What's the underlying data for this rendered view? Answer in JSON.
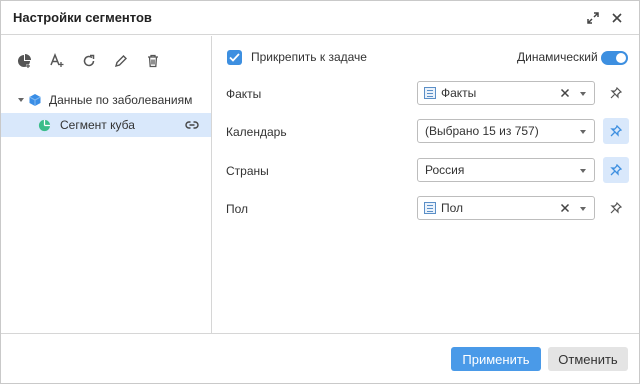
{
  "dialog": {
    "title": "Настройки сегментов"
  },
  "tree": {
    "root_label": "Данные по заболеваниям",
    "child_label": "Сегмент куба"
  },
  "options": {
    "pin_to_task_label": "Прикрепить к задаче",
    "pin_to_task_checked": true,
    "dynamic_label": "Динамический",
    "dynamic_on": true
  },
  "fields": [
    {
      "label": "Факты",
      "value": "Факты"
    },
    {
      "label": "Календарь",
      "value": "(Выбрано 15 из 757)"
    },
    {
      "label": "Страны",
      "value": "Россия"
    },
    {
      "label": "Пол",
      "value": "Пол"
    }
  ],
  "footer": {
    "apply_label": "Применить",
    "cancel_label": "Отменить"
  },
  "colors": {
    "accent": "#3d8fe0",
    "primary_button": "#4a9ae8",
    "selection": "#d9e8fb",
    "cube_icon": "#3a8ee6",
    "segment_icon": "#3bbd8a"
  }
}
